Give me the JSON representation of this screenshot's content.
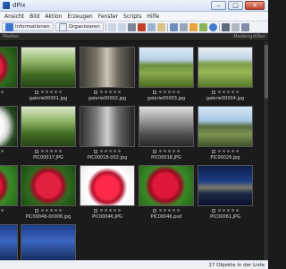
{
  "window": {
    "title": "dPix"
  },
  "menu": [
    "Ansicht",
    "Bild",
    "Aktion",
    "Erzeugen",
    "Fenster",
    "Scripts",
    "Hilfe"
  ],
  "toolbar": {
    "info_label": "Informationen",
    "organize_label": "Organisieren"
  },
  "pathbar": {
    "left": "Medien",
    "right": "Mediengrößen"
  },
  "colors": {
    "grid_bg": "#1b1b1b",
    "titlebar": "#d6e4f5",
    "close": "#c0412a"
  },
  "thumbnails": [
    {
      "caption": "",
      "img": "img-rose"
    },
    {
      "caption": "galerie00001.jpg",
      "img": "img-garden"
    },
    {
      "caption": "galerie00002.jpg",
      "img": "img-statue"
    },
    {
      "caption": "galerie00003.jpg",
      "img": "img-vineyard"
    },
    {
      "caption": "galerie00004.jpg",
      "img": "img-vineyard2"
    },
    {
      "caption": "",
      "img": "img-white"
    },
    {
      "caption": "PIC00017.JPG",
      "img": "img-garden"
    },
    {
      "caption": "PIC00018-002.jpg",
      "img": "img-statue-bw"
    },
    {
      "caption": "PIC00018.JPG",
      "img": "img-garden-bw"
    },
    {
      "caption": "PIC00026.jpg",
      "img": "img-landscape"
    },
    {
      "caption": "",
      "img": "img-rose3"
    },
    {
      "caption": "PIC00046-00006.jpg",
      "img": "img-rose"
    },
    {
      "caption": "PIC00046.JPG",
      "img": "img-rose2"
    },
    {
      "caption": "PIC00046.psd",
      "img": "img-rose3"
    },
    {
      "caption": "PIC00061.JPG",
      "img": "img-castle"
    },
    {
      "caption": "",
      "img": "img-blue"
    },
    {
      "caption": "",
      "img": "img-blue"
    }
  ],
  "status": {
    "text": "17 Objekte in der Liste"
  }
}
